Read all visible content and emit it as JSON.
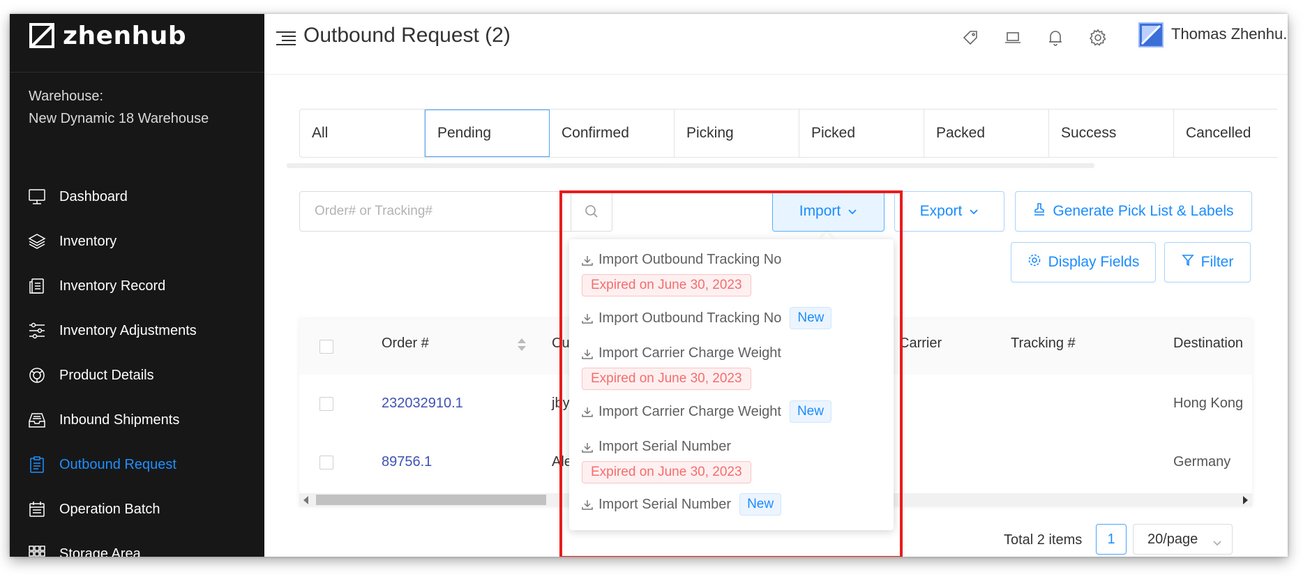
{
  "app": {
    "brand": "zhenhub"
  },
  "sidebar": {
    "warehouse_label": "Warehouse:",
    "warehouse_name": "New Dynamic 18 Warehouse",
    "items": [
      {
        "label": "Dashboard",
        "icon": "monitor-icon"
      },
      {
        "label": "Inventory",
        "icon": "layers-icon"
      },
      {
        "label": "Inventory Record",
        "icon": "record-icon"
      },
      {
        "label": "Inventory Adjustments",
        "icon": "sliders-icon"
      },
      {
        "label": "Product Details",
        "icon": "product-icon"
      },
      {
        "label": "Inbound Shipments",
        "icon": "inbox-icon"
      },
      {
        "label": "Outbound Request",
        "icon": "clipboard-icon",
        "active": true
      },
      {
        "label": "Operation Batch",
        "icon": "calendar-icon"
      },
      {
        "label": "Storage Area",
        "icon": "grid-icon"
      }
    ]
  },
  "header": {
    "title": "Outbound Request (2)",
    "user_name": "Thomas Zhenhu..",
    "icons": [
      "tag-icon",
      "laptop-icon",
      "bell-icon",
      "gear-icon"
    ]
  },
  "tabs": [
    "All",
    "Pending",
    "Confirmed",
    "Picking",
    "Picked",
    "Packed",
    "Success",
    "Cancelled"
  ],
  "selected_tab": "Pending",
  "search": {
    "placeholder": "Order# or Tracking#",
    "value": ""
  },
  "toolbar": {
    "import_label": "Import",
    "export_label": "Export",
    "generate_label": "Generate Pick List & Labels",
    "display_fields_label": "Display Fields",
    "filter_label": "Filter"
  },
  "import_menu": {
    "items": [
      {
        "label": "Import Outbound Tracking No",
        "expired": "Expired on June 30, 2023"
      },
      {
        "label": "Import Outbound Tracking No",
        "badge": "New"
      },
      {
        "label": "Import Carrier Charge Weight",
        "expired": "Expired on June 30, 2023"
      },
      {
        "label": "Import Carrier Charge Weight",
        "badge": "New"
      },
      {
        "label": "Import Serial Number",
        "expired": "Expired on June 30, 2023"
      },
      {
        "label": "Import Serial Number",
        "badge": "New"
      }
    ]
  },
  "table": {
    "columns": [
      "Order #",
      "Cus",
      "Carrier",
      "Tracking #",
      "Destination"
    ],
    "rows": [
      {
        "order": "232032910.1",
        "customer": "jby",
        "destination": "Hong Kong"
      },
      {
        "order": "89756.1",
        "customer": "Ale",
        "destination": "Germany"
      }
    ]
  },
  "pagination": {
    "total": "Total 2 items",
    "page": "1",
    "per_page": "20/page"
  },
  "colors": {
    "accent": "#1a8cff",
    "sidebar_bg": "#171717",
    "highlight": "#e81c1c",
    "expired": "#f56c6c"
  }
}
